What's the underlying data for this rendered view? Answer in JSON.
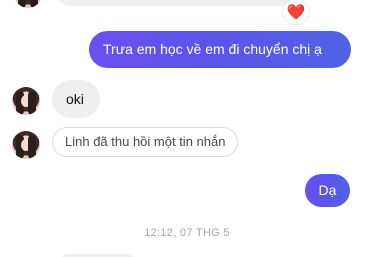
{
  "messages": [
    {
      "text": "Trưa em học về em đi chuyển chị ạ"
    },
    {
      "text": "oki"
    },
    {
      "text": "Linh đã thu hồi một tin nhắn"
    },
    {
      "text": "Dạ"
    }
  ],
  "reaction": {
    "emoji": "❤️"
  },
  "timestamp": "12:12, 07 THG 5",
  "colors": {
    "sent_bubble": "#5a55ea",
    "received_bubble": "#efefef",
    "heart": "#e0243d"
  }
}
